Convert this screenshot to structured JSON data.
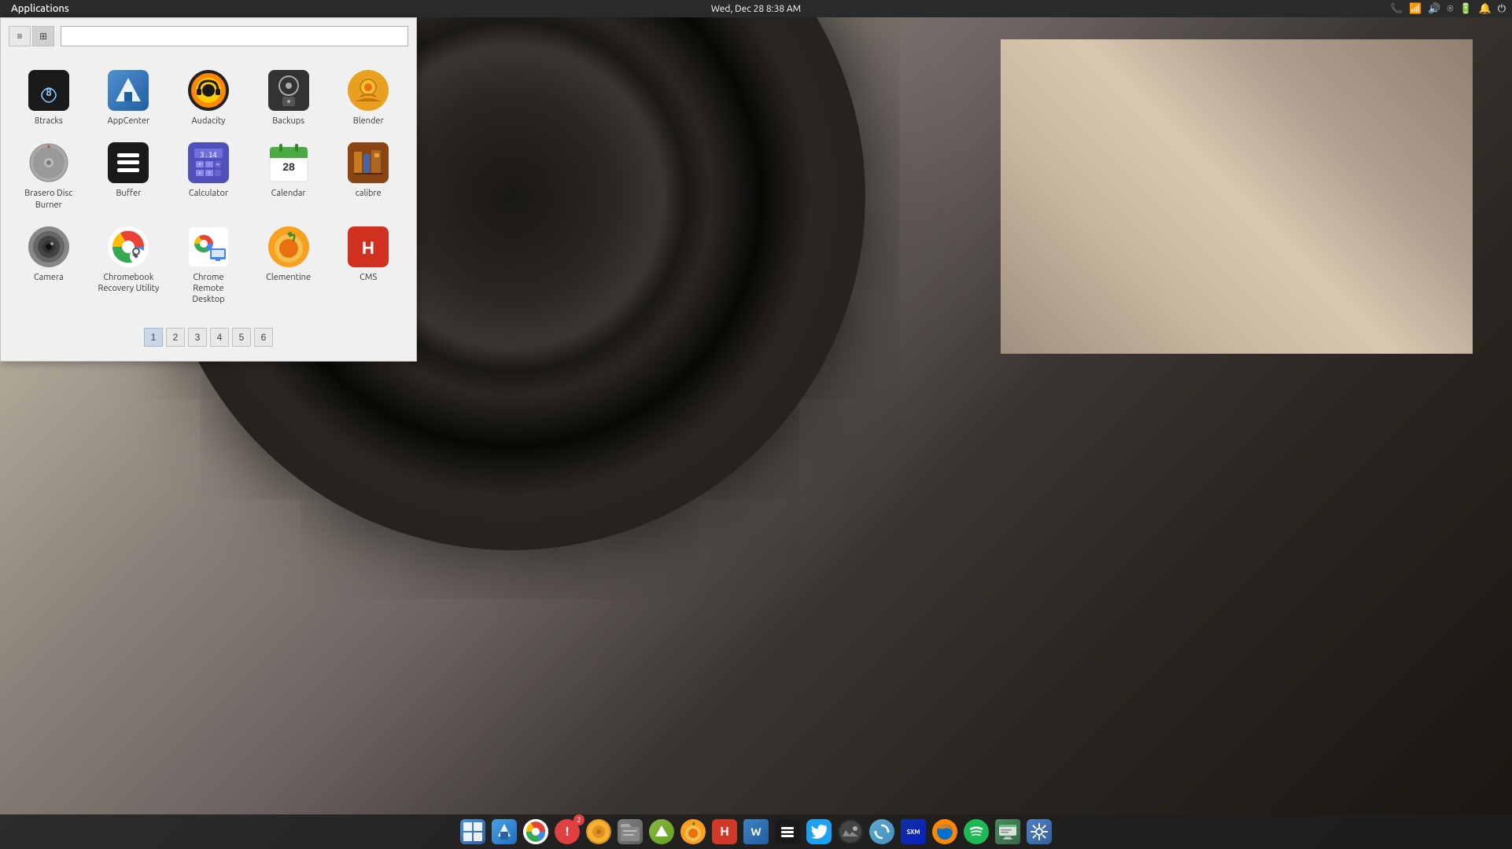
{
  "topPanel": {
    "appsMenu": "Applications",
    "datetime": "Wed, Dec 28  8:38 AM",
    "icons": [
      "phone",
      "network",
      "volume",
      "wifi",
      "battery",
      "notification",
      "power"
    ]
  },
  "launcher": {
    "searchPlaceholder": "",
    "searchValue": "",
    "viewModes": [
      "list",
      "grid"
    ],
    "apps": [
      {
        "id": "8tracks",
        "label": "8tracks",
        "iconType": "8tracks"
      },
      {
        "id": "appcenter",
        "label": "AppCenter",
        "iconType": "appcenter"
      },
      {
        "id": "audacity",
        "label": "Audacity",
        "iconType": "audacity"
      },
      {
        "id": "backups",
        "label": "Backups",
        "iconType": "backups"
      },
      {
        "id": "blender",
        "label": "Blender",
        "iconType": "blender"
      },
      {
        "id": "brasero",
        "label": "Brasero Disc Burner",
        "iconType": "brasero"
      },
      {
        "id": "buffer",
        "label": "Buffer",
        "iconType": "buffer"
      },
      {
        "id": "calculator",
        "label": "Calculator",
        "iconType": "calculator"
      },
      {
        "id": "calendar",
        "label": "Calendar",
        "iconType": "calendar"
      },
      {
        "id": "calibre",
        "label": "calibre",
        "iconType": "calibre"
      },
      {
        "id": "camera",
        "label": "Camera",
        "iconType": "camera"
      },
      {
        "id": "chromebook",
        "label": "Chromebook Recovery Utility",
        "iconType": "chromebook"
      },
      {
        "id": "chrome-remote",
        "label": "Chrome Remote Desktop",
        "iconType": "chrome-remote"
      },
      {
        "id": "clementine",
        "label": "Clementine",
        "iconType": "clementine"
      },
      {
        "id": "cms",
        "label": "CMS",
        "iconType": "cms"
      }
    ],
    "pagination": {
      "pages": [
        "1",
        "2",
        "3",
        "4",
        "5",
        "6"
      ],
      "activePage": "1"
    }
  },
  "taskbar": {
    "items": [
      {
        "id": "start",
        "label": "Start Menu",
        "type": "tb-start",
        "icon": "⊞"
      },
      {
        "id": "appget",
        "label": "AppCenter",
        "type": "tb-appget",
        "icon": "↓"
      },
      {
        "id": "chrome",
        "label": "Chrome",
        "type": "tb-chrome",
        "icon": ""
      },
      {
        "id": "updates",
        "label": "Updates",
        "type": "tb-updates",
        "icon": "!",
        "badge": "2"
      },
      {
        "id": "mint",
        "label": "Mint",
        "type": "tb-mint",
        "icon": "◉"
      },
      {
        "id": "files",
        "label": "Files",
        "type": "tb-files",
        "icon": "🗂"
      },
      {
        "id": "mintup",
        "label": "Mint Update",
        "type": "tb-mintup",
        "icon": "⬆"
      },
      {
        "id": "orange",
        "label": "Clementine",
        "type": "tb-orange",
        "icon": "◕"
      },
      {
        "id": "hiri",
        "label": "Hiri",
        "type": "tb-hiri",
        "icon": "H"
      },
      {
        "id": "writer",
        "label": "Writer",
        "type": "tb-writer",
        "icon": "W"
      },
      {
        "id": "buffer",
        "label": "Buffer",
        "type": "tb-buffer",
        "icon": "≡"
      },
      {
        "id": "twitter",
        "label": "Twitter",
        "type": "tb-twitter",
        "icon": "🐦"
      },
      {
        "id": "photo",
        "label": "Photo",
        "type": "tb-photo",
        "icon": "◎"
      },
      {
        "id": "pair",
        "label": "Pair",
        "type": "tb-pair",
        "icon": "⟳"
      },
      {
        "id": "sxm",
        "label": "SiriusXM",
        "type": "tb-sxm",
        "icon": "SXM"
      },
      {
        "id": "firefox",
        "label": "Firefox",
        "type": "tb-firefox",
        "icon": "🦊"
      },
      {
        "id": "spotify",
        "label": "Spotify",
        "type": "tb-spotify",
        "icon": "♫"
      },
      {
        "id": "mint2",
        "label": "Mint Welcome",
        "type": "tb-mint2",
        "icon": "≋"
      },
      {
        "id": "settings",
        "label": "Settings",
        "type": "tb-settings",
        "icon": "❖"
      }
    ]
  }
}
